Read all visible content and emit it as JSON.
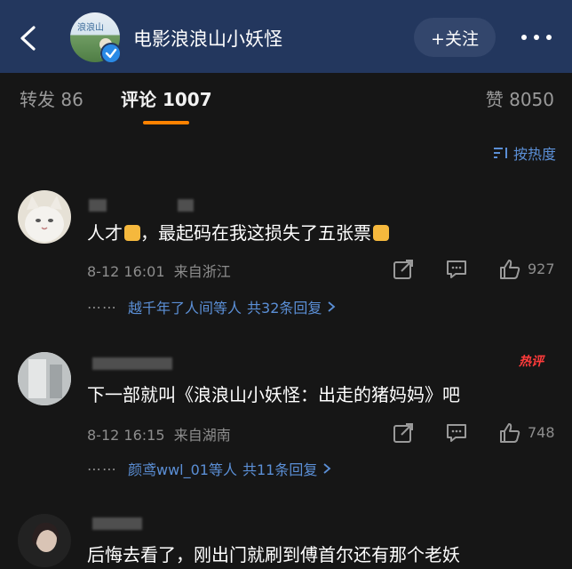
{
  "header": {
    "channel_name": "电影浪浪山小妖怪",
    "follow_label": "+关注",
    "avatar_mark": "浪浪山",
    "icons": {
      "back": "back-arrow-icon",
      "more": "more-dots-icon",
      "verified": "verified-badge-icon"
    },
    "colors": {
      "background": "#23375e",
      "follow_bg": "#33466c",
      "verified": "#2a8ae6"
    }
  },
  "tabs": {
    "repost": "转发 86",
    "comments": "评论 1007",
    "likes": "赞 8050",
    "active_color": "#ff8200"
  },
  "sort_label": "按热度",
  "comments": [
    {
      "text": "人才, 最起码在我这损失了五张票",
      "text_parts": [
        "人才",
        "，最起码在我这损失了五张票"
      ],
      "date": "8-12 16:01",
      "location": "来自浙江",
      "likes": "927",
      "reply_dots": "⋯⋯",
      "reply_users": "越千年了人间等人",
      "reply_total": "共32条回复"
    },
    {
      "text": "下一部就叫《浪浪山小妖怪：出走的猪妈妈》吧",
      "date": "8-12 16:15",
      "location": "来自湖南",
      "likes": "748",
      "hot_badge": "热评",
      "reply_dots": "⋯⋯",
      "reply_users": "颜鸢wwl_01等人",
      "reply_total": "共11条回复"
    },
    {
      "text": "后悔去看了，刚出门就刷到傅首尔还有那个老妖"
    }
  ]
}
